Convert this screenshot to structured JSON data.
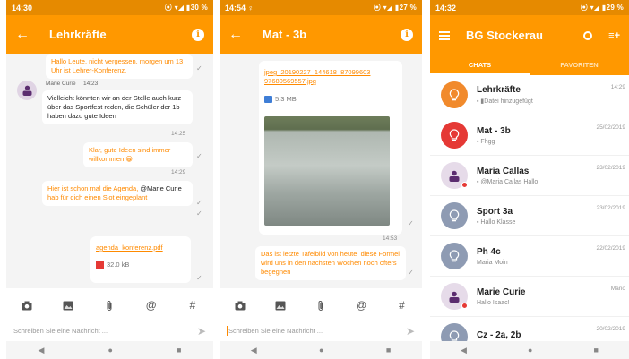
{
  "screen1": {
    "status": {
      "time": "14:30",
      "indicators": "⦿ ▾◢ ▮30 %"
    },
    "title": "Lehrkräfte",
    "messages": [
      {
        "text": "Hallo Leute, nicht vergessen, morgen um 13 Uhr ist Lehrer-Konferenz."
      },
      {
        "sender": "Marie Curie",
        "sender_time": "14:23",
        "text": "Vielleicht könnten wir an der Stelle auch kurz über das Sportfest reden, die Schüler der 1b haben dazu gute Ideen",
        "time": "14:25"
      },
      {
        "text": "Klar, gute Ideen sind immer willkommen 😀",
        "time": "14:29"
      },
      {
        "text_a": "Hier ist schon mal die Agenda, ",
        "mention": "@Marie Curie",
        "text_b": " hab für dich einen Slot eingeplant"
      },
      {
        "file": "agenda_konferenz.pdf",
        "size": "32.0 kB"
      }
    ],
    "composer_placeholder": "Schreiben Sie eine Nachricht ..."
  },
  "screen2": {
    "status": {
      "time": "14:54",
      "extra": "♀",
      "indicators": "⦿ ▾◢ ▮27 %"
    },
    "title": "Mat - 3b",
    "messages": [
      {
        "file": "jpeg_20190227_144618_87099603 97680569557.jpg",
        "size": "5.3 MB",
        "time": "14:53"
      },
      {
        "text": "Das ist letzte  Tafelbild von heute, diese Formel wird uns in den nächsten Wochen noch öfters begegnen"
      }
    ],
    "composer_placeholder": "Schreiben Sie eine Nachricht ..."
  },
  "screen3": {
    "status": {
      "time": "14:32",
      "indicators": "⦿ ▾◢ ▮29 %"
    },
    "title": "BG Stockerau",
    "tabs": [
      "CHATS",
      "FAVORITEN"
    ],
    "chats": [
      {
        "name": "Lehrkräfte",
        "preview": "▪ ▮Datei hinzugefügt",
        "date": "14:29",
        "color": "#f18a2c",
        "icon": "bulb-icon",
        "dot": false
      },
      {
        "name": "Mat - 3b",
        "preview": "▪ Fhgg",
        "date": "25/02/2019",
        "color": "#e53935",
        "icon": "bulb-icon",
        "dot": false
      },
      {
        "name": "Maria Callas",
        "preview": "▪ @Maria Callas  Hallo",
        "date": "23/02/2019",
        "color": "#e6dbe9",
        "icon": "person-icon",
        "dot": true
      },
      {
        "name": "Sport 3a",
        "preview": "▪ Hallo Klasse",
        "date": "23/02/2019",
        "color": "#8e9bb3",
        "icon": "bulb-icon",
        "dot": false
      },
      {
        "name": "Ph 4c",
        "preview": "Maria  Moin",
        "date": "22/02/2019",
        "color": "#8e9bb3",
        "icon": "bulb-icon",
        "dot": false
      },
      {
        "name": "Marie Curie",
        "preview": "Hallo Isaac!",
        "date": "Mario",
        "color": "#e6dbe9",
        "icon": "person-icon",
        "dot": true
      },
      {
        "name": "Cz - 2a, 2b",
        "preview": "",
        "date": "20/02/2019",
        "color": "#8e9bb3",
        "icon": "bulb-icon",
        "dot": false
      }
    ]
  },
  "nav": {
    "back": "◀",
    "home": "●",
    "recent": "■"
  },
  "colors": {
    "accent": "#ff9800",
    "status": "#e68a00",
    "outgoing_text": "#ff8a00"
  }
}
